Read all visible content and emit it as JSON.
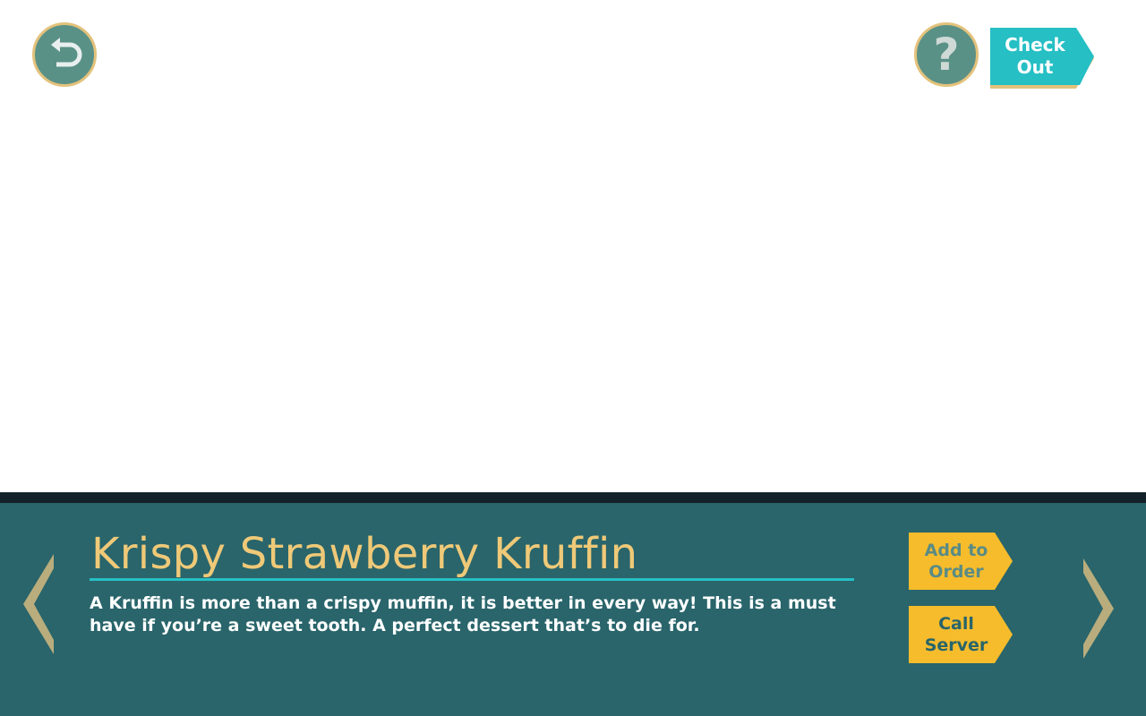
{
  "header": {
    "back_icon": "undo-arrow-icon",
    "help_icon": "question-mark-icon",
    "help_glyph": "?",
    "checkout_label": "Check\nOut"
  },
  "item": {
    "title": "Krispy Strawberry Kruffin",
    "description": "A Kruffin is more than a crispy muffin, it is better in every way! This is a must have if you’re a sweet tooth. A perfect dessert that’s to die for."
  },
  "actions": {
    "add_to_order_label": "Add to\nOrder",
    "call_server_label": "Call\nServer"
  },
  "navigation": {
    "prev_icon": "chevron-left-icon",
    "next_icon": "chevron-right-icon"
  },
  "colors": {
    "panel": "#29656b",
    "panel_topbar": "#13212a",
    "title": "#efc978",
    "accent_teal": "#25bfc4",
    "round_button": "#5a9187",
    "round_button_border": "#e3c27c",
    "tag_yellow": "#f6bc2c",
    "tag_text": "#5a8b85",
    "chevron": "#b9ad7d"
  }
}
